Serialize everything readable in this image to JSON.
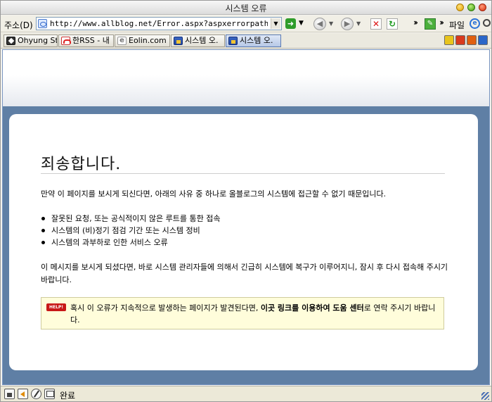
{
  "window": {
    "title": "시스템 오류"
  },
  "addressbar": {
    "label": "주소(D)",
    "url": "http://www.allblog.net/Error.aspx?aspxerrorpath=/home/def",
    "file_menu": "파일"
  },
  "tabs": [
    {
      "label": "Ohyung Sto",
      "icon": "dark-diamond-icon"
    },
    {
      "label": "한RSS - 내",
      "icon": "rss-icon"
    },
    {
      "label": "Eolin.com",
      "icon": "e-page-icon"
    },
    {
      "label": "시스템 오.",
      "icon": "window-icon"
    },
    {
      "label": "시스템 오.",
      "icon": "window-icon",
      "active": true
    }
  ],
  "page": {
    "heading": "죄송합니다.",
    "intro": "만약 이 페이지를 보시게 되신다면, 아래의 사유 중 하나로 올블로그의 시스템에 접근할 수 없기 때문입니다.",
    "reasons": [
      "잘못된 요청, 또는 공식적이지 않은 루트를 통한 접속",
      "시스템의 (비)정기 점검 기간 또는 시스템 정비",
      "시스템의 과부하로 인한 서비스 오류"
    ],
    "notice": "이 메시지를 보시게 되셨다면, 바로 시스템 관리자들에 의해서 긴급히 시스템에 복구가 이루어지니, 잠시 후 다시 접속해 주시기 바랍니다.",
    "help": {
      "badge": "HELP!",
      "text_before": "혹시 이 오류가 지속적으로 발생하는 페이지가 발견된다면, ",
      "link": "이곳 링크를 이용하여 도움 센터",
      "text_after": "로 연락 주시기 바랍니다."
    }
  },
  "status": {
    "text": "완료"
  }
}
